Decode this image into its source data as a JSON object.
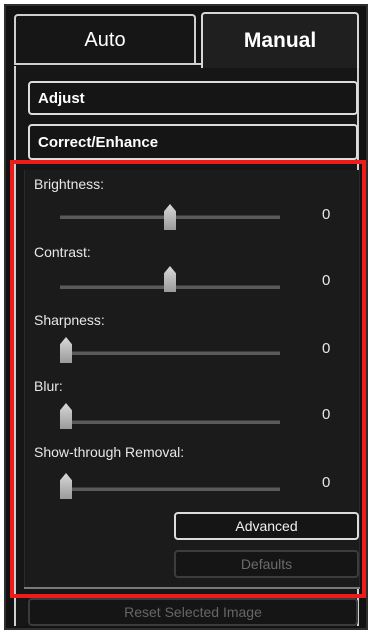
{
  "tabs": [
    {
      "label": "Auto",
      "active": false
    },
    {
      "label": "Manual",
      "active": true
    }
  ],
  "sections": {
    "adjust_label": "Adjust",
    "correct_label": "Correct/Enhance"
  },
  "sliders": [
    {
      "label": "Brightness:",
      "value": "0",
      "position_fraction": 0.5
    },
    {
      "label": "Contrast:",
      "value": "0",
      "position_fraction": 0.5
    },
    {
      "label": "Sharpness:",
      "value": "0",
      "position_fraction": 0.0
    },
    {
      "label": "Blur:",
      "value": "0",
      "position_fraction": 0.0
    },
    {
      "label": "Show-through Removal:",
      "value": "0",
      "position_fraction": 0.0
    }
  ],
  "buttons": {
    "advanced_label": "Advanced",
    "defaults_label": "Defaults",
    "reset_label": "Reset Selected Image"
  },
  "colors": {
    "highlight": "#ee1b1b",
    "background": "#161616"
  }
}
